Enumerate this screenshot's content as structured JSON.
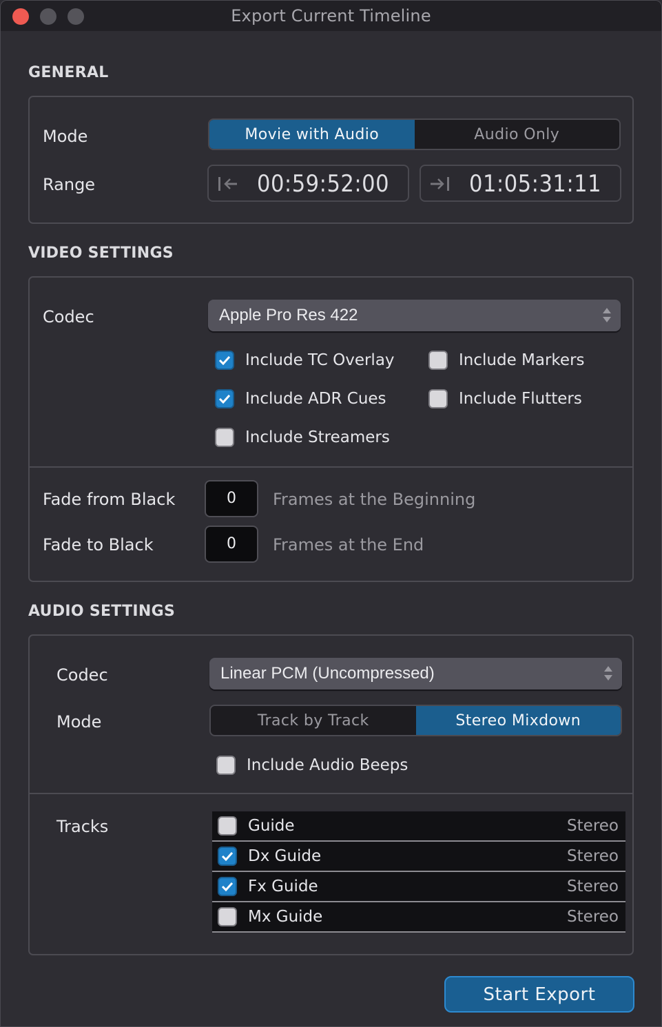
{
  "window": {
    "title": "Export Current Timeline",
    "controls": [
      "close",
      "minimize",
      "maximize"
    ]
  },
  "general": {
    "section_title": "GENERAL",
    "mode_label": "Mode",
    "mode_options": [
      "Movie with Audio",
      "Audio Only"
    ],
    "mode_selected": "Movie with Audio",
    "range_label": "Range",
    "range_in_icon": "range-start-icon",
    "range_in": "00:59:52:00",
    "range_out_icon": "range-end-icon",
    "range_out": "01:05:31:11"
  },
  "video": {
    "section_title": "VIDEO SETTINGS",
    "codec_label": "Codec",
    "codec_value": "Apple Pro Res 422",
    "options": [
      {
        "label": "Include TC Overlay",
        "checked": true
      },
      {
        "label": "Include Markers",
        "checked": false
      },
      {
        "label": "Include ADR Cues",
        "checked": true
      },
      {
        "label": "Include Flutters",
        "checked": false
      },
      {
        "label": "Include Streamers",
        "checked": false
      }
    ],
    "fade_from_black_label": "Fade from Black",
    "fade_from_black_value": "0",
    "fade_from_black_hint": "Frames at the Beginning",
    "fade_to_black_label": "Fade to Black",
    "fade_to_black_value": "0",
    "fade_to_black_hint": "Frames at the End"
  },
  "audio": {
    "section_title": "AUDIO SETTINGS",
    "codec_label": "Codec",
    "codec_value": "Linear PCM (Uncompressed)",
    "mode_label": "Mode",
    "mode_options": [
      "Track by Track",
      "Stereo Mixdown"
    ],
    "mode_selected": "Stereo Mixdown",
    "beeps": {
      "label": "Include Audio Beeps",
      "checked": false
    },
    "tracks_label": "Tracks",
    "tracks": [
      {
        "name": "Guide",
        "type": "Stereo",
        "checked": false
      },
      {
        "name": "Dx Guide",
        "type": "Stereo",
        "checked": true
      },
      {
        "name": "Fx Guide",
        "type": "Stereo",
        "checked": true
      },
      {
        "name": "Mx Guide",
        "type": "Stereo",
        "checked": false
      }
    ]
  },
  "footer": {
    "export_label": "Start Export"
  },
  "colors": {
    "accent": "#1b5e8e",
    "checkbox_checked": "#1f82c9",
    "close_button": "#ee5a52",
    "background": "#2e2d33"
  }
}
